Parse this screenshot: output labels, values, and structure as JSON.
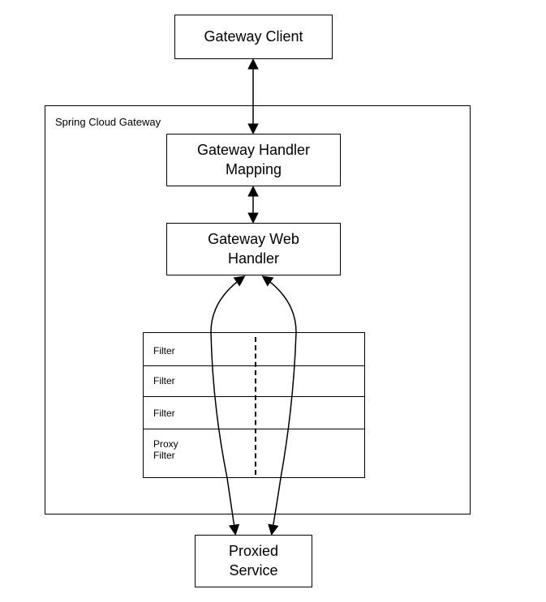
{
  "nodes": {
    "client": "Gateway Client",
    "container": "Spring Cloud Gateway",
    "handler_mapping": "Gateway Handler\nMapping",
    "web_handler": "Gateway Web\nHandler",
    "filters": {
      "f1": "Filter",
      "f2": "Filter",
      "f3": "Filter",
      "proxy": "Proxy\nFilter"
    },
    "proxied": "Proxied\nService"
  }
}
